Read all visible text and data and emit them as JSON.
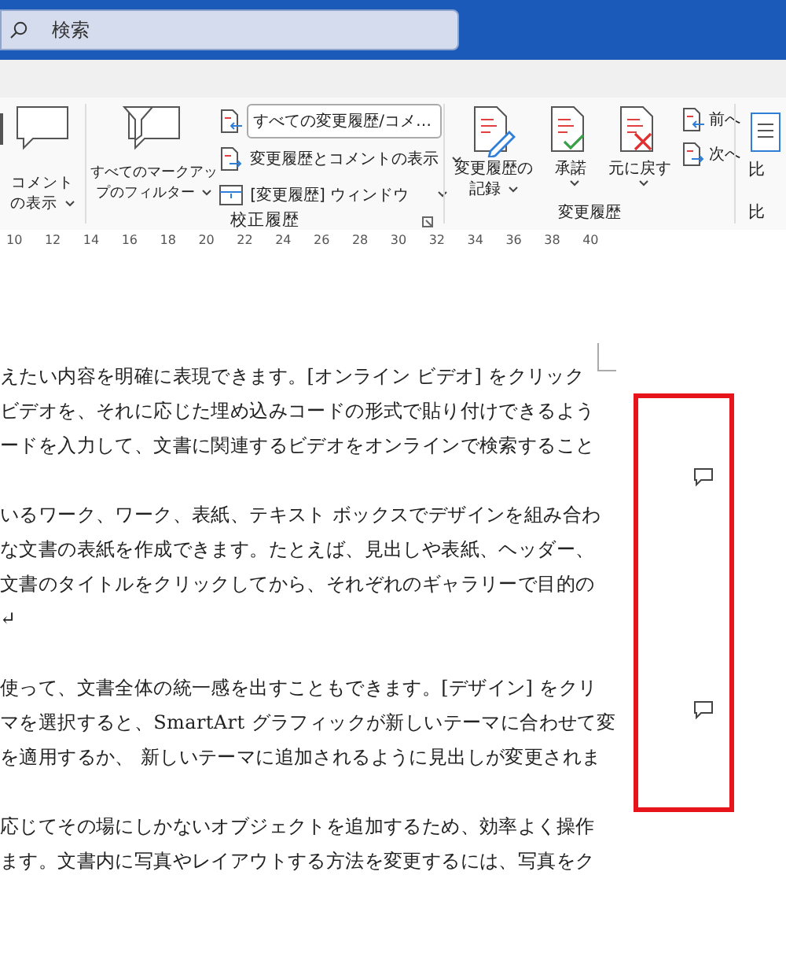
{
  "search": {
    "placeholder": "検索"
  },
  "ribbon": {
    "comments_button": {
      "lines": [
        "コメント",
        "の表示"
      ]
    },
    "tracking": {
      "label": "校正履歴",
      "markup_filter": {
        "lines": [
          "すべてのマークアッ",
          "プのフィルター"
        ]
      },
      "display_select": {
        "value": "すべての変更履歴/コメ…"
      },
      "show_markup": "変更履歴とコメントの表示",
      "reviewing_pane": "[変更履歴] ウィンドウ"
    },
    "changes": {
      "label": "変更履歴",
      "buttons": [
        {
          "kind": "record",
          "lines": [
            "変更履歴の",
            "記録"
          ]
        },
        {
          "kind": "accept",
          "lines": [
            "承諾"
          ]
        },
        {
          "kind": "reject",
          "lines": [
            "元に戻す"
          ]
        }
      ],
      "nav": [
        {
          "kind": "previous",
          "label": "前へ"
        },
        {
          "kind": "next",
          "label": "次へ"
        }
      ]
    },
    "compare": {
      "button": "比",
      "label": "比"
    }
  },
  "ruler": [
    "10",
    "12",
    "14",
    "16",
    "18",
    "20",
    "22",
    "24",
    "26",
    "28",
    "30",
    "32",
    "34",
    "36",
    "38",
    "40"
  ],
  "document": {
    "paragraphs": [
      {
        "lines": [
          "えたい内容を明確に表現できます。[オンライン ビデオ] をクリック",
          "ビデオを、それに応じた埋め込みコードの形式で貼り付けできるよう",
          "ードを入力して、文書に関連するビデオをオンラインで検索すること"
        ]
      },
      {
        "lines": [
          "いるワーク、ワーク、表紙、テキスト ボックスでデザインを組み合わ",
          "な文書の表紙を作成できます。たとえば、見出しや表紙、ヘッダー、",
          "文書のタイトルをクリックしてから、それぞれのギャラリーで目的の",
          "↵"
        ]
      },
      {
        "lines": [
          "使って、文書全体の統一感を出すこともできます。[デザイン] をクリ",
          "マを選択すると、SmartArt グラフィックが新しいテーマに合わせて変",
          "を適用するか、 新しいテーマに追加されるように見出しが変更されま"
        ]
      },
      {
        "lines": [
          "応じてその場にしかないオブジェクトを追加するため、効率よく操作",
          "ます。文書内に写真やレイアウトする方法を変更するには、写真をク"
        ]
      }
    ],
    "comment_markers": [
      {
        "kind": "comment"
      },
      {
        "kind": "comment"
      }
    ]
  }
}
